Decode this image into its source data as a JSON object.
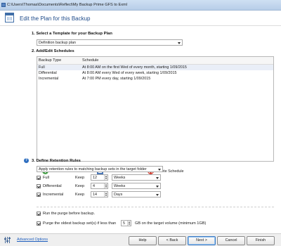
{
  "window": {
    "title": "C:\\Users\\Thomas\\Documents\\Reflect\\My Backup Prime GFS to Exml"
  },
  "header": {
    "title": "Edit the Plan for this Backup"
  },
  "section1": {
    "title": "1. Select a Template for your Backup Plan",
    "template_value": "Definition backup plan"
  },
  "section2": {
    "title": "2. Add/Edit Schedules",
    "columns": [
      "Backup Type",
      "Schedule"
    ],
    "rows": [
      {
        "type": "Full",
        "schedule": "At 8:00 AM on the first Wed of every month, starting 1/09/2015"
      },
      {
        "type": "Differential",
        "schedule": "At 8:00 AM every Wed of every week, starting 1/09/2015"
      },
      {
        "type": "Incremental",
        "schedule": "At 7:00 PM every day, starting 1/09/2015"
      }
    ],
    "add_label": "Add Schedule",
    "edit_label": "Edit Schedule",
    "delete_label": "Delete Schedule"
  },
  "section3": {
    "title": "3. Define Retention Rules",
    "rule_value": "Apply retention rules to matching backup sets in the target folder",
    "rules": [
      {
        "label": "Full",
        "keep": "Keep",
        "value": "12",
        "unit": "Weeks"
      },
      {
        "label": "Differential",
        "keep": "Keep",
        "value": "4",
        "unit": "Weeks"
      },
      {
        "label": "Incremental",
        "keep": "Keep",
        "value": "14",
        "unit": "Days"
      }
    ]
  },
  "options": {
    "purge_before": "Run the purge before backup.",
    "purge_oldest_prefix": "Purge the oldest backup set(s) if less than",
    "purge_oldest_value": "5",
    "purge_oldest_suffix": "GB on the target volume (minimum 1GB)"
  },
  "footer": {
    "advanced": "Advanced Options",
    "help": "Help",
    "back": "< Back",
    "next": "Next >",
    "cancel": "Cancel",
    "finish": "Finish"
  }
}
